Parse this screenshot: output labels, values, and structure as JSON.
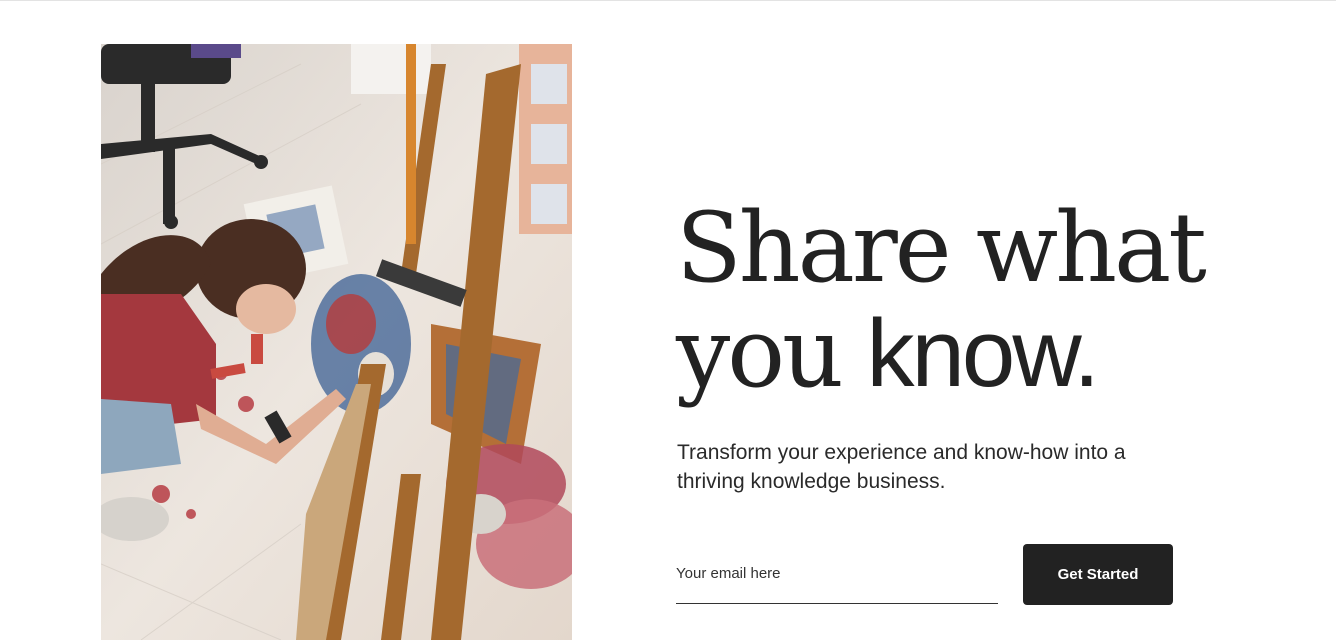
{
  "hero": {
    "image_alt_icon": "painting-artist-photo",
    "headline_line1": "Share what",
    "headline_line2_a": "you",
    "headline_line2_b": "know.",
    "subtext": "Transform your experience and know-how into a thriving knowledge business."
  },
  "signup": {
    "email_placeholder": "Your email here",
    "email_value": "",
    "button_label": "Get Started"
  },
  "colors": {
    "text": "#222222",
    "button_bg": "#222222",
    "button_text": "#ffffff",
    "background": "#ffffff"
  }
}
